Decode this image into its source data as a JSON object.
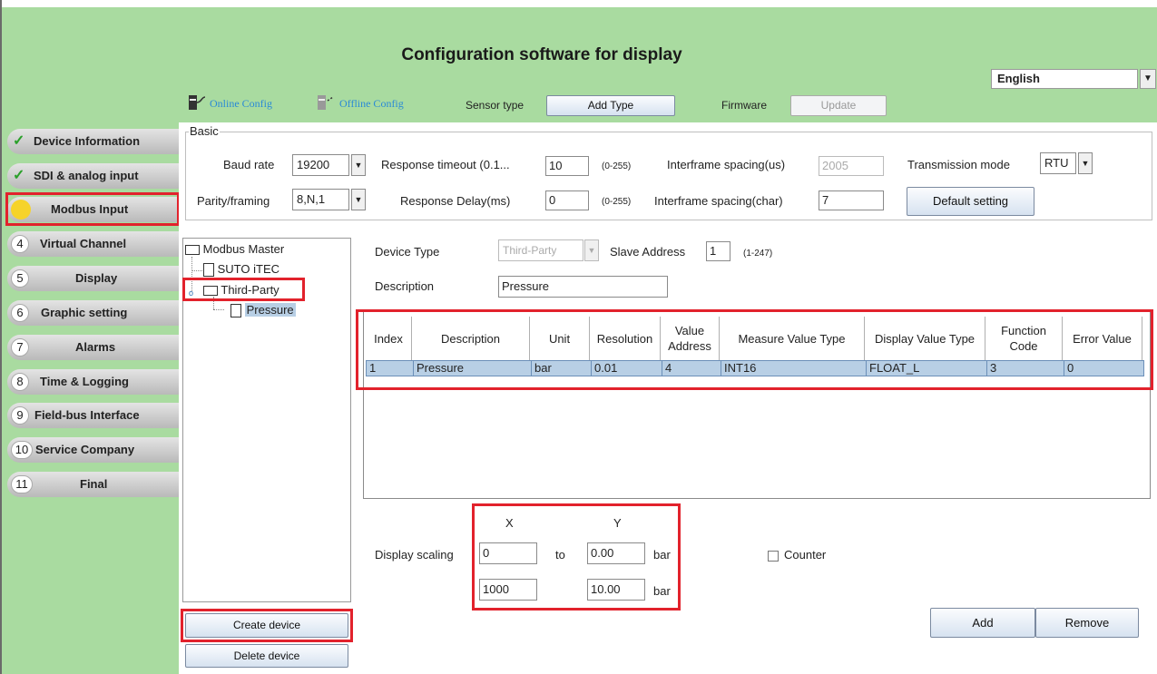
{
  "header": {
    "title": "Configuration software for display",
    "language": "English"
  },
  "toolbar": {
    "online_config": "Online Config",
    "offline_config": "Offline Config",
    "sensor_type_label": "Sensor type",
    "add_type": "Add Type",
    "firmware_label": "Firmware",
    "update": "Update"
  },
  "sidebar": {
    "items": [
      {
        "num": "",
        "label": "Device Information",
        "state": "done"
      },
      {
        "num": "",
        "label": "SDI & analog input",
        "state": "done"
      },
      {
        "num": "",
        "label": "Modbus Input",
        "state": "active"
      },
      {
        "num": "4",
        "label": "Virtual Channel",
        "state": "pending"
      },
      {
        "num": "5",
        "label": "Display",
        "state": "pending"
      },
      {
        "num": "6",
        "label": "Graphic setting",
        "state": "pending"
      },
      {
        "num": "7",
        "label": "Alarms",
        "state": "pending"
      },
      {
        "num": "8",
        "label": "Time & Logging",
        "state": "pending"
      },
      {
        "num": "9",
        "label": "Field-bus Interface",
        "state": "pending"
      },
      {
        "num": "10",
        "label": "Service Company",
        "state": "pending"
      },
      {
        "num": "11",
        "label": "Final",
        "state": "pending"
      }
    ]
  },
  "basic": {
    "legend": "Basic",
    "baud_rate_label": "Baud rate",
    "baud_rate": "19200",
    "response_timeout_label": "Response timeout (0.1...",
    "response_timeout": "10",
    "response_timeout_range": "(0-255)",
    "interframe_us_label": "Interframe spacing(us)",
    "interframe_us": "2005",
    "transmission_mode_label": "Transmission mode",
    "transmission_mode": "RTU",
    "parity_label": "Parity/framing",
    "parity": "8,N,1",
    "response_delay_label": "Response Delay(ms)",
    "response_delay": "0",
    "response_delay_range": "(0-255)",
    "interframe_char_label": "Interframe spacing(char)",
    "interframe_char": "7",
    "default_setting": "Default setting"
  },
  "tree": {
    "root": "Modbus Master",
    "child1": "SUTO iTEC",
    "child2": "Third-Party",
    "leaf": "Pressure"
  },
  "device": {
    "device_type_label": "Device Type",
    "device_type": "Third-Party",
    "slave_address_label": "Slave Address",
    "slave_address": "1",
    "slave_range": "(1-247)",
    "description_label": "Description",
    "description": "Pressure"
  },
  "table": {
    "headers": [
      "Index",
      "Description",
      "Unit",
      "Resolution",
      "Value Address",
      "Measure Value Type",
      "Display Value Type",
      "Function Code",
      "Error Value"
    ],
    "rows": [
      [
        "1",
        "Pressure",
        "bar",
        "0.01",
        "4",
        "INT16",
        "FLOAT_L",
        "3",
        "0"
      ]
    ]
  },
  "scaling": {
    "x_header": "X",
    "y_header": "Y",
    "label": "Display scaling",
    "x1": "0",
    "to": "to",
    "y1": "0.00",
    "unit1": "bar",
    "x2": "1000",
    "y2": "10.00",
    "unit2": "bar",
    "counter_label": "Counter"
  },
  "buttons": {
    "create_device": "Create device",
    "delete_device": "Delete device",
    "add": "Add",
    "remove": "Remove"
  }
}
